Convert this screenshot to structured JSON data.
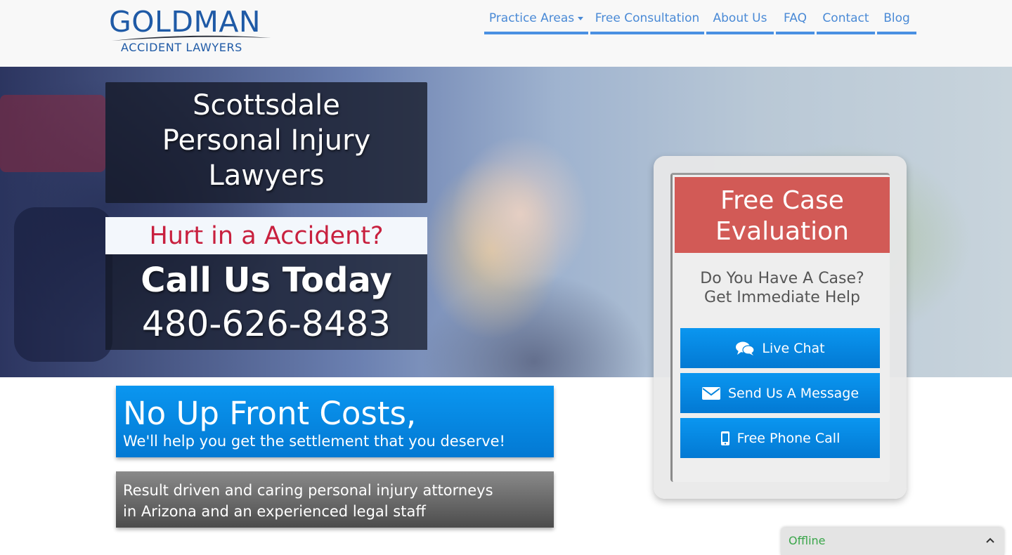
{
  "header": {
    "logo": {
      "top": "GOLDMAN",
      "bottom": "ACCIDENT LAWYERS"
    },
    "nav": [
      {
        "label": "Practice Areas",
        "has_caret": true
      },
      {
        "label": "Free Consultation"
      },
      {
        "label": "About Us"
      },
      {
        "label": "FAQ"
      },
      {
        "label": "Contact"
      },
      {
        "label": "Blog"
      }
    ]
  },
  "hero": {
    "title_line1": "Scottsdale",
    "title_line2": "Personal Injury",
    "title_line3": "Lawyers",
    "hurt": "Hurt in a Accident?",
    "call_today": "Call Us Today",
    "phone": "480-626-8483"
  },
  "panels": {
    "blue_big": "No Up Front Costs,",
    "blue_small": "We'll help you get the settlement that you deserve!",
    "gray_line1": "Result driven and caring personal injury attorneys",
    "gray_line2": "in Arizona and an experienced legal staff"
  },
  "evaluation": {
    "title_line1": "Free Case",
    "title_line2": "Evaluation",
    "sub_line1": "Do You Have A Case?",
    "sub_line2": "Get Immediate Help",
    "buttons": [
      {
        "label": "Live Chat",
        "icon": "chat-bubbles-icon"
      },
      {
        "label": "Send Us A Message",
        "icon": "envelope-icon"
      },
      {
        "label": "Free Phone Call",
        "icon": "mobile-phone-icon"
      }
    ]
  },
  "chat_widget": {
    "status": "Offline"
  },
  "colors": {
    "brand_blue": "#1f5aa6",
    "nav_blue": "#4a8ad6",
    "accent_red": "#c8203e",
    "eval_header_red": "#d25a56",
    "button_blue": "#0379d3",
    "offline_green": "#3aa64a"
  }
}
